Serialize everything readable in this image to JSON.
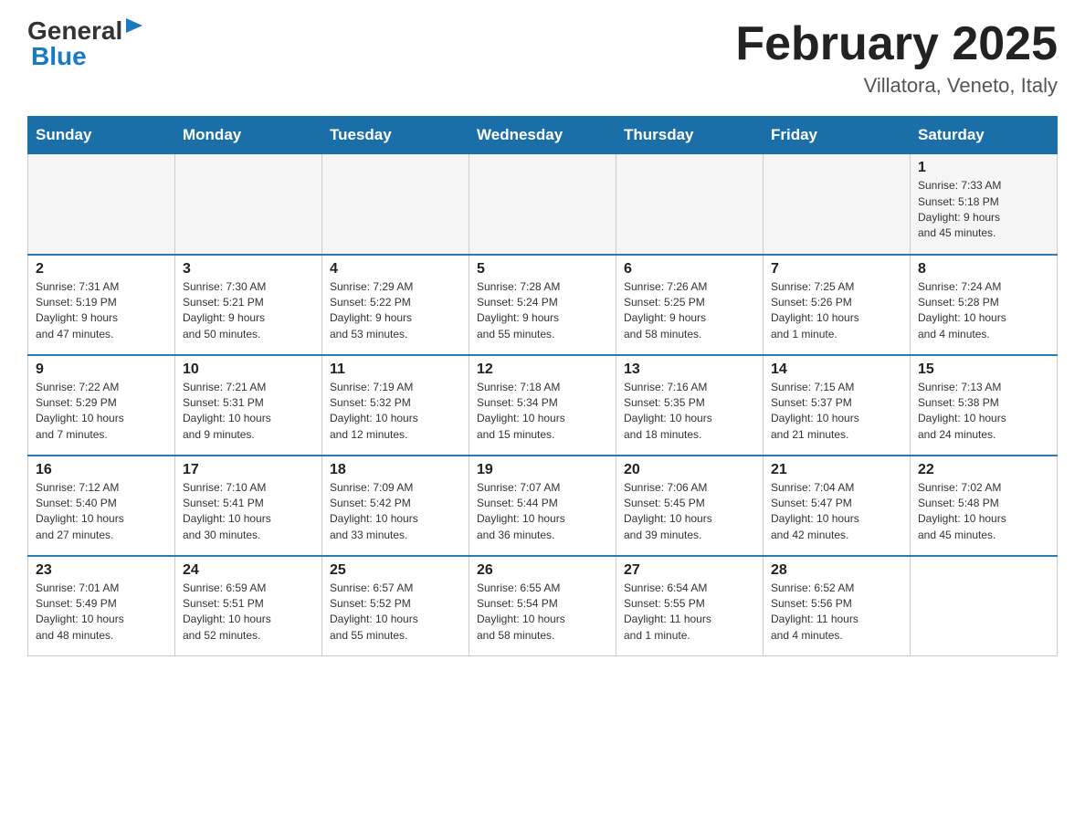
{
  "logo": {
    "general": "General",
    "blue": "Blue"
  },
  "header": {
    "month": "February 2025",
    "location": "Villatora, Veneto, Italy"
  },
  "weekdays": [
    "Sunday",
    "Monday",
    "Tuesday",
    "Wednesday",
    "Thursday",
    "Friday",
    "Saturday"
  ],
  "weeks": [
    [
      {
        "day": "",
        "info": ""
      },
      {
        "day": "",
        "info": ""
      },
      {
        "day": "",
        "info": ""
      },
      {
        "day": "",
        "info": ""
      },
      {
        "day": "",
        "info": ""
      },
      {
        "day": "",
        "info": ""
      },
      {
        "day": "1",
        "info": "Sunrise: 7:33 AM\nSunset: 5:18 PM\nDaylight: 9 hours\nand 45 minutes."
      }
    ],
    [
      {
        "day": "2",
        "info": "Sunrise: 7:31 AM\nSunset: 5:19 PM\nDaylight: 9 hours\nand 47 minutes."
      },
      {
        "day": "3",
        "info": "Sunrise: 7:30 AM\nSunset: 5:21 PM\nDaylight: 9 hours\nand 50 minutes."
      },
      {
        "day": "4",
        "info": "Sunrise: 7:29 AM\nSunset: 5:22 PM\nDaylight: 9 hours\nand 53 minutes."
      },
      {
        "day": "5",
        "info": "Sunrise: 7:28 AM\nSunset: 5:24 PM\nDaylight: 9 hours\nand 55 minutes."
      },
      {
        "day": "6",
        "info": "Sunrise: 7:26 AM\nSunset: 5:25 PM\nDaylight: 9 hours\nand 58 minutes."
      },
      {
        "day": "7",
        "info": "Sunrise: 7:25 AM\nSunset: 5:26 PM\nDaylight: 10 hours\nand 1 minute."
      },
      {
        "day": "8",
        "info": "Sunrise: 7:24 AM\nSunset: 5:28 PM\nDaylight: 10 hours\nand 4 minutes."
      }
    ],
    [
      {
        "day": "9",
        "info": "Sunrise: 7:22 AM\nSunset: 5:29 PM\nDaylight: 10 hours\nand 7 minutes."
      },
      {
        "day": "10",
        "info": "Sunrise: 7:21 AM\nSunset: 5:31 PM\nDaylight: 10 hours\nand 9 minutes."
      },
      {
        "day": "11",
        "info": "Sunrise: 7:19 AM\nSunset: 5:32 PM\nDaylight: 10 hours\nand 12 minutes."
      },
      {
        "day": "12",
        "info": "Sunrise: 7:18 AM\nSunset: 5:34 PM\nDaylight: 10 hours\nand 15 minutes."
      },
      {
        "day": "13",
        "info": "Sunrise: 7:16 AM\nSunset: 5:35 PM\nDaylight: 10 hours\nand 18 minutes."
      },
      {
        "day": "14",
        "info": "Sunrise: 7:15 AM\nSunset: 5:37 PM\nDaylight: 10 hours\nand 21 minutes."
      },
      {
        "day": "15",
        "info": "Sunrise: 7:13 AM\nSunset: 5:38 PM\nDaylight: 10 hours\nand 24 minutes."
      }
    ],
    [
      {
        "day": "16",
        "info": "Sunrise: 7:12 AM\nSunset: 5:40 PM\nDaylight: 10 hours\nand 27 minutes."
      },
      {
        "day": "17",
        "info": "Sunrise: 7:10 AM\nSunset: 5:41 PM\nDaylight: 10 hours\nand 30 minutes."
      },
      {
        "day": "18",
        "info": "Sunrise: 7:09 AM\nSunset: 5:42 PM\nDaylight: 10 hours\nand 33 minutes."
      },
      {
        "day": "19",
        "info": "Sunrise: 7:07 AM\nSunset: 5:44 PM\nDaylight: 10 hours\nand 36 minutes."
      },
      {
        "day": "20",
        "info": "Sunrise: 7:06 AM\nSunset: 5:45 PM\nDaylight: 10 hours\nand 39 minutes."
      },
      {
        "day": "21",
        "info": "Sunrise: 7:04 AM\nSunset: 5:47 PM\nDaylight: 10 hours\nand 42 minutes."
      },
      {
        "day": "22",
        "info": "Sunrise: 7:02 AM\nSunset: 5:48 PM\nDaylight: 10 hours\nand 45 minutes."
      }
    ],
    [
      {
        "day": "23",
        "info": "Sunrise: 7:01 AM\nSunset: 5:49 PM\nDaylight: 10 hours\nand 48 minutes."
      },
      {
        "day": "24",
        "info": "Sunrise: 6:59 AM\nSunset: 5:51 PM\nDaylight: 10 hours\nand 52 minutes."
      },
      {
        "day": "25",
        "info": "Sunrise: 6:57 AM\nSunset: 5:52 PM\nDaylight: 10 hours\nand 55 minutes."
      },
      {
        "day": "26",
        "info": "Sunrise: 6:55 AM\nSunset: 5:54 PM\nDaylight: 10 hours\nand 58 minutes."
      },
      {
        "day": "27",
        "info": "Sunrise: 6:54 AM\nSunset: 5:55 PM\nDaylight: 11 hours\nand 1 minute."
      },
      {
        "day": "28",
        "info": "Sunrise: 6:52 AM\nSunset: 5:56 PM\nDaylight: 11 hours\nand 4 minutes."
      },
      {
        "day": "",
        "info": ""
      }
    ]
  ]
}
